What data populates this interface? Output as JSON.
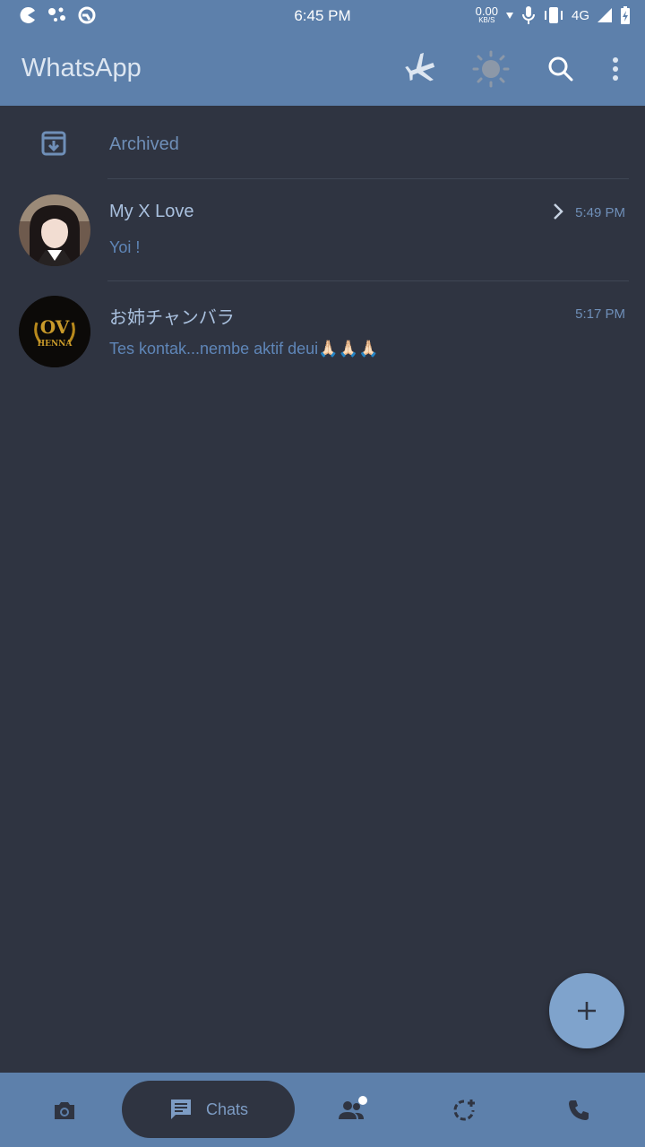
{
  "status_bar": {
    "time": "6:45 PM",
    "net_speed_value": "0.00",
    "net_speed_unit": "KB/S",
    "network": "4G",
    "icons": [
      "pacman-icon",
      "assistant-icon",
      "sync-icon",
      "mic-icon",
      "vibrate-icon",
      "signal-icon",
      "battery-charging-icon"
    ]
  },
  "app_bar": {
    "title": "WhatsApp",
    "icons": [
      "airplane-mode-icon",
      "brightness-icon",
      "search-icon",
      "more-vert-icon"
    ]
  },
  "archived": {
    "label": "Archived",
    "icon": "archive-icon"
  },
  "chats": [
    {
      "name": "My X Love",
      "time": "5:49 PM",
      "message": "Yoi !",
      "has_chevron": true
    },
    {
      "name": "お姉チャンバラ",
      "time": "5:17 PM",
      "message": "Tes kontak...nembe aktif deui🙏🏻🙏🏻🙏🏻",
      "avatar_text_top": "OV",
      "avatar_text_bottom": "HENNA"
    }
  ],
  "fab": {
    "icon": "plus-icon"
  },
  "bottom_nav": {
    "items": [
      {
        "icon": "camera-icon"
      },
      {
        "icon": "chat-icon",
        "label": "Chats",
        "active": true
      },
      {
        "icon": "group-icon",
        "has_badge": true
      },
      {
        "icon": "status-icon"
      },
      {
        "icon": "phone-icon"
      }
    ]
  },
  "colors": {
    "bar": "#5d80ab",
    "background": "#2f3441",
    "accent_text": "#6f8fb8",
    "fab": "#7fa3cc"
  }
}
